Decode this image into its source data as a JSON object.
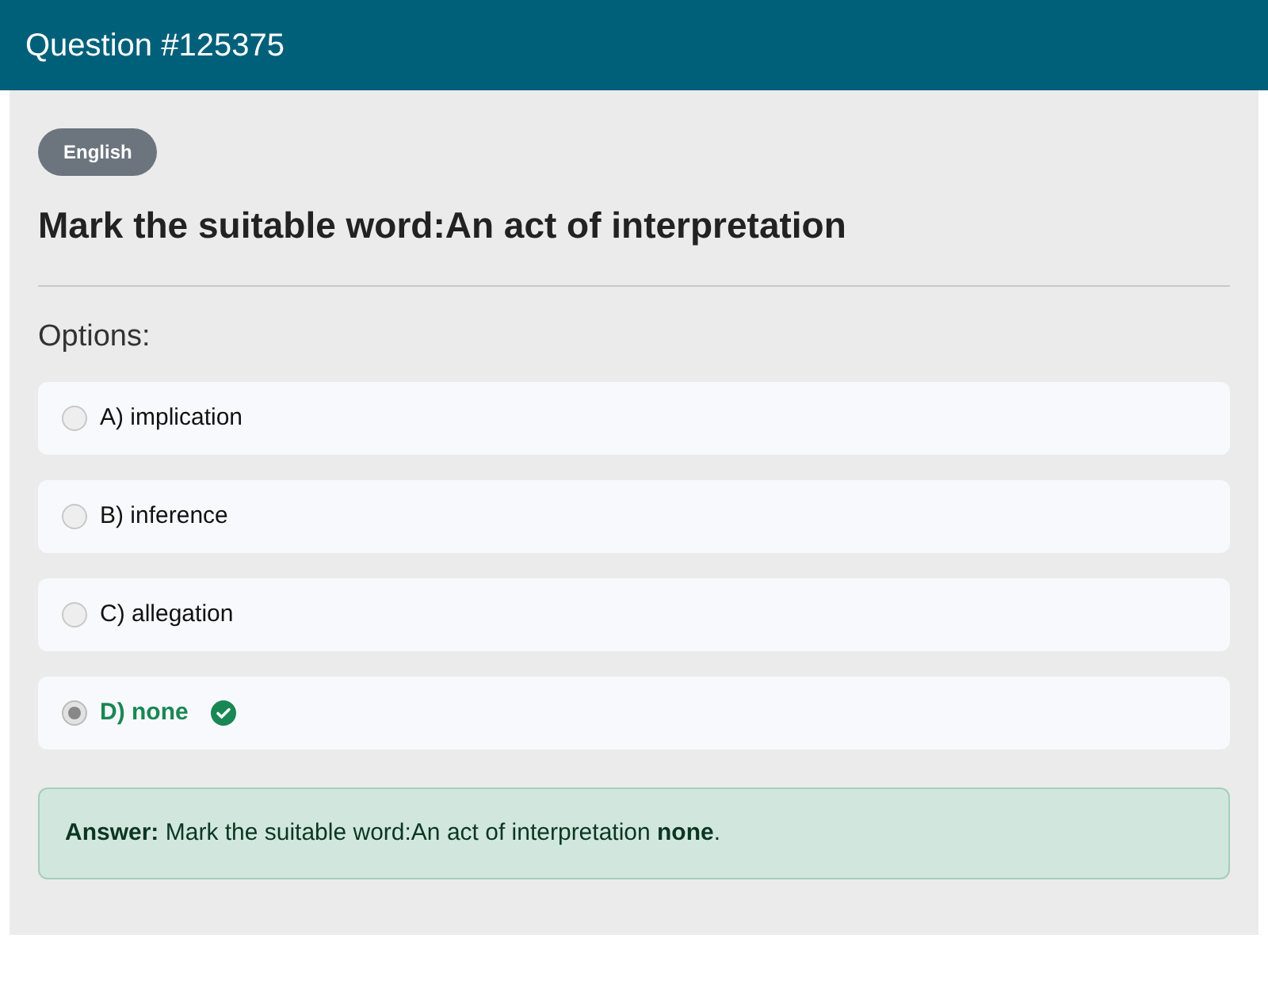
{
  "header": {
    "title": "Question #125375"
  },
  "badge": "English",
  "question": "Mark the suitable word:An act of interpretation",
  "options_label": "Options:",
  "options": [
    {
      "label": "A) implication",
      "selected": false,
      "correct": false
    },
    {
      "label": "B) inference",
      "selected": false,
      "correct": false
    },
    {
      "label": "C) allegation",
      "selected": false,
      "correct": false
    },
    {
      "label": "D) none",
      "selected": true,
      "correct": true
    }
  ],
  "answer": "**Answer:** Mark the suitable word:An act of interpretation **none**."
}
